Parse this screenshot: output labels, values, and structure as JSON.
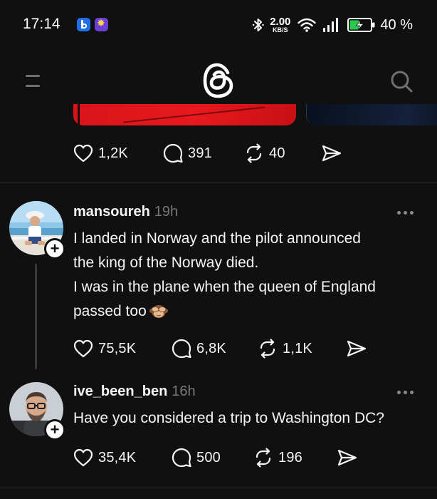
{
  "status_bar": {
    "time": "17:14",
    "net_speed_value": "2.00",
    "net_speed_unit": "KB/S",
    "battery_percent": "40 %",
    "app_icons": [
      "bing-icon",
      "star-app-icon"
    ],
    "system_icons": [
      "bluetooth-icon",
      "wifi-icon",
      "cellular-signal-icon",
      "battery-charging-icon"
    ]
  },
  "header": {
    "menu_icon": "menu-icon",
    "logo": "threads-logo",
    "search_icon": "search-icon"
  },
  "top_post": {
    "likes": "1,2K",
    "replies": "391",
    "reposts": "40"
  },
  "posts": [
    {
      "username": "mansoureh",
      "time": "19h",
      "lines": [
        "I landed in Norway and the pilot announced",
        "the king of the Norway died.",
        "I was in the plane when the queen of England",
        "passed too"
      ],
      "emoji": "see-no-evil-monkey",
      "likes": "75,5K",
      "replies": "6,8K",
      "reposts": "1,1K"
    },
    {
      "username": "ive_been_ben",
      "time": "16h",
      "lines": [
        "Have you considered a trip to Washington DC?"
      ],
      "likes": "35,4K",
      "replies": "500",
      "reposts": "196"
    }
  ],
  "colors": {
    "background": "#101010",
    "text": "#f3f5f7",
    "muted": "#777777",
    "divider": "#2d2d2d"
  }
}
